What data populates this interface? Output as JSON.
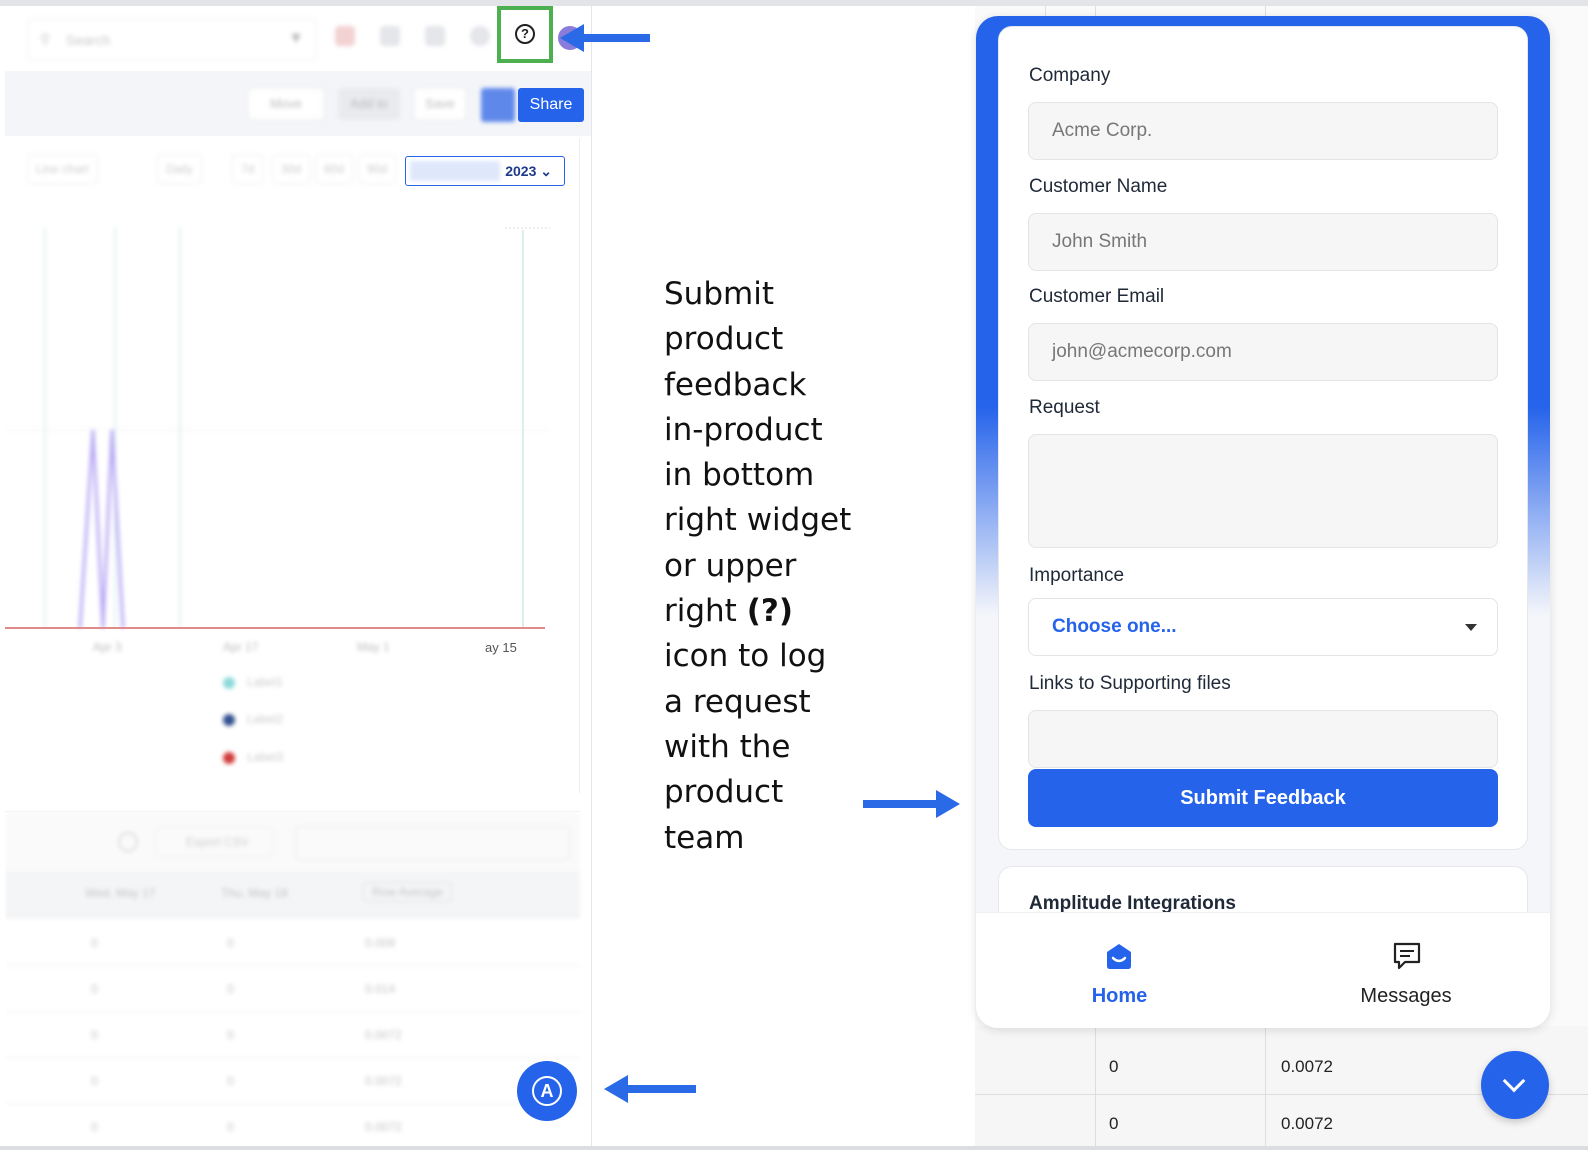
{
  "left_app": {
    "search_placeholder": "Search",
    "toolbar": {
      "move_label": "Move",
      "add_to_label": "Add to",
      "save_label": "Save",
      "share_label": "Share"
    },
    "filters": [
      "Line chart",
      "Daily",
      "7d",
      "30d",
      "60d",
      "90d"
    ],
    "date_range_suffix": "2023",
    "x_ticks": [
      "Apr 3",
      "Apr 17",
      "May 1"
    ],
    "x_tick_last": "ay 15",
    "legend": [
      "Label1",
      "Label2",
      "Label3"
    ],
    "table_tools": {
      "export_label": "Export CSV"
    },
    "table_headers": [
      "Wed, May 17",
      "Thu, May 18",
      "Row Average"
    ],
    "table_rows": [
      [
        "0",
        "0",
        "0.009"
      ],
      [
        "0",
        "0",
        "0.014"
      ],
      [
        "0",
        "0",
        "0.0072"
      ],
      [
        "0",
        "0",
        "0.0072"
      ],
      [
        "0",
        "0",
        "0.0072"
      ]
    ]
  },
  "instructions": {
    "lines": [
      "Submit",
      "product",
      "feedback",
      "in-product",
      "in bottom",
      "right widget",
      "or upper"
    ],
    "line_right": "right",
    "line_right_bold": "(?)",
    "lines_after": [
      "icon to log",
      "a request",
      "with the",
      "product",
      "team"
    ]
  },
  "widget": {
    "company_label": "Company",
    "company_placeholder": "Acme Corp.",
    "customer_name_label": "Customer Name",
    "customer_name_placeholder": "John Smith",
    "customer_email_label": "Customer Email",
    "customer_email_placeholder": "john@acmecorp.com",
    "request_label": "Request",
    "importance_label": "Importance",
    "importance_value": "Choose one...",
    "links_label": "Links to Supporting files",
    "submit_label": "Submit Feedback",
    "integrations_title": "Amplitude Integrations",
    "nav": {
      "home": "Home",
      "messages": "Messages"
    }
  },
  "background_table": {
    "rows": [
      [
        "0",
        "0.0072"
      ],
      [
        "0",
        "0.0072"
      ]
    ]
  },
  "colors": {
    "accent": "#2563eb",
    "highlight_border": "#4caf50",
    "arrow": "#2b6ae6"
  }
}
